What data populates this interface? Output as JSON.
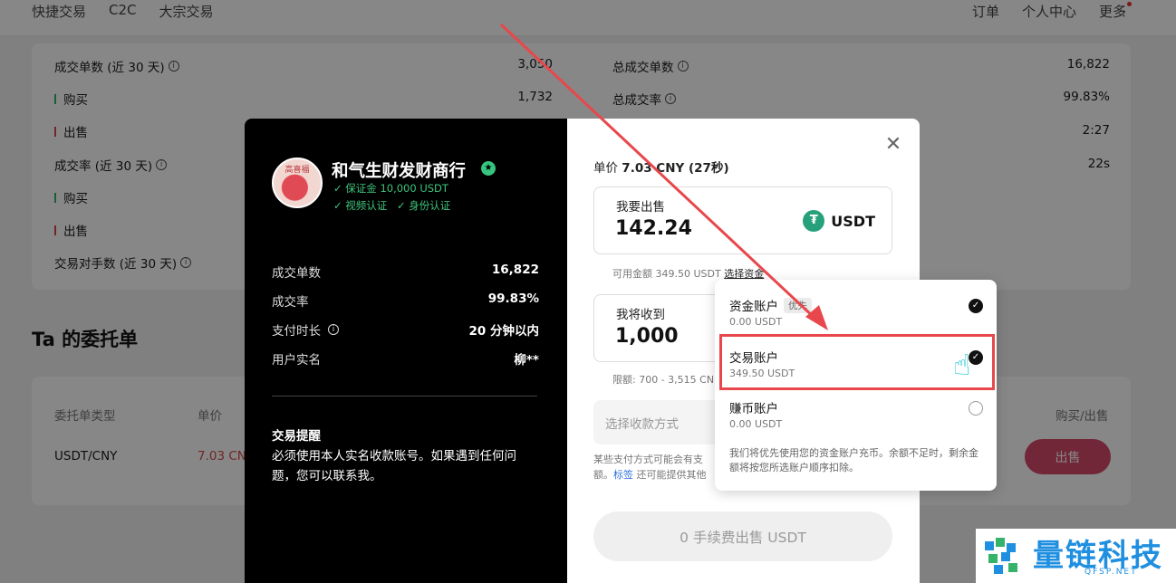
{
  "nav": {
    "left": [
      "快捷交易",
      "C2C",
      "大宗交易"
    ],
    "right": [
      "订单",
      "个人中心",
      "更多"
    ],
    "more_icon": "kebab-icon"
  },
  "stats": {
    "left": [
      {
        "label": "成交单数 (近 30 天)",
        "value": "3,050"
      },
      {
        "label": "购买",
        "value": "1,732"
      },
      {
        "label": "出售",
        "value": ""
      },
      {
        "label": "成交率 (近 30 天)",
        "value": ""
      },
      {
        "label": "购买",
        "value": ""
      },
      {
        "label": "出售",
        "value": ""
      },
      {
        "label": "交易对手数 (近 30 天)",
        "value": ""
      }
    ],
    "right": [
      {
        "label": "总成交单数",
        "value": "16,822"
      },
      {
        "label": "总成交率",
        "value": "99.83%"
      },
      {
        "label": "",
        "value": "2:27"
      },
      {
        "label": "",
        "value": "22s"
      }
    ]
  },
  "orders": {
    "title": "Ta 的委托单",
    "headers": [
      "委托单类型",
      "单价",
      "购买/出售"
    ],
    "row": {
      "type": "USDT/CNY",
      "price": "7.03 CNY",
      "action": "出售"
    }
  },
  "merchant": {
    "avatar_text": "高喜福",
    "name": "和气生财发财商行",
    "deposit": "✓ 保证金 10,000 USDT",
    "verify_video": "✓ 视频认证",
    "verify_id": "✓ 身份认证",
    "stats": [
      {
        "label": "成交单数",
        "value": "16,822"
      },
      {
        "label": "成交率",
        "value": "99.83%"
      },
      {
        "label": "支付时长",
        "value": "20 分钟以内"
      },
      {
        "label": "用户实名",
        "value": "柳**"
      }
    ],
    "tip_title": "交易提醒",
    "tip_text": "必须使用本人实名收款账号。如果遇到任何问题，您可以联系我。"
  },
  "trade": {
    "unit_price_label": "单价",
    "unit_price_value": "7.03 CNY (27秒)",
    "sell_label": "我要出售",
    "sell_amount": "142.24",
    "currency": "USDT",
    "available": "可用金额 349.50 USDT",
    "choose_account": "选择资金",
    "receive_label": "我将收到",
    "receive_amount": "1,000",
    "limit": "限额: 700 - 3,515 CN",
    "payment_placeholder": "选择收款方式",
    "warn_pre": "某些支付方式可能会有支",
    "warn_mid": "额。",
    "warn_link": "标签",
    "warn_post": "还可能提供其他",
    "submit": "0 手续费出售 USDT"
  },
  "accounts": {
    "items": [
      {
        "name": "资金账户",
        "tag": "优先",
        "balance": "0.00 USDT",
        "checked": true
      },
      {
        "name": "交易账户",
        "tag": "",
        "balance": "349.50 USDT",
        "checked": true
      },
      {
        "name": "赚币账户",
        "tag": "",
        "balance": "0.00 USDT",
        "checked": false
      }
    ],
    "note": "我们将优先使用您的资金账户充币。余额不足时，剩余金额将按您所选账户顺序扣除。"
  },
  "watermark": {
    "cn": "量链科技",
    "en": "QFSP.NET"
  },
  "colors": {
    "accent_green": "#36c47e",
    "sell_red": "#d84a6a",
    "highlight_red": "#e8474b",
    "tether": "#26a17b",
    "watermark_blue": "#1f8fe0"
  }
}
